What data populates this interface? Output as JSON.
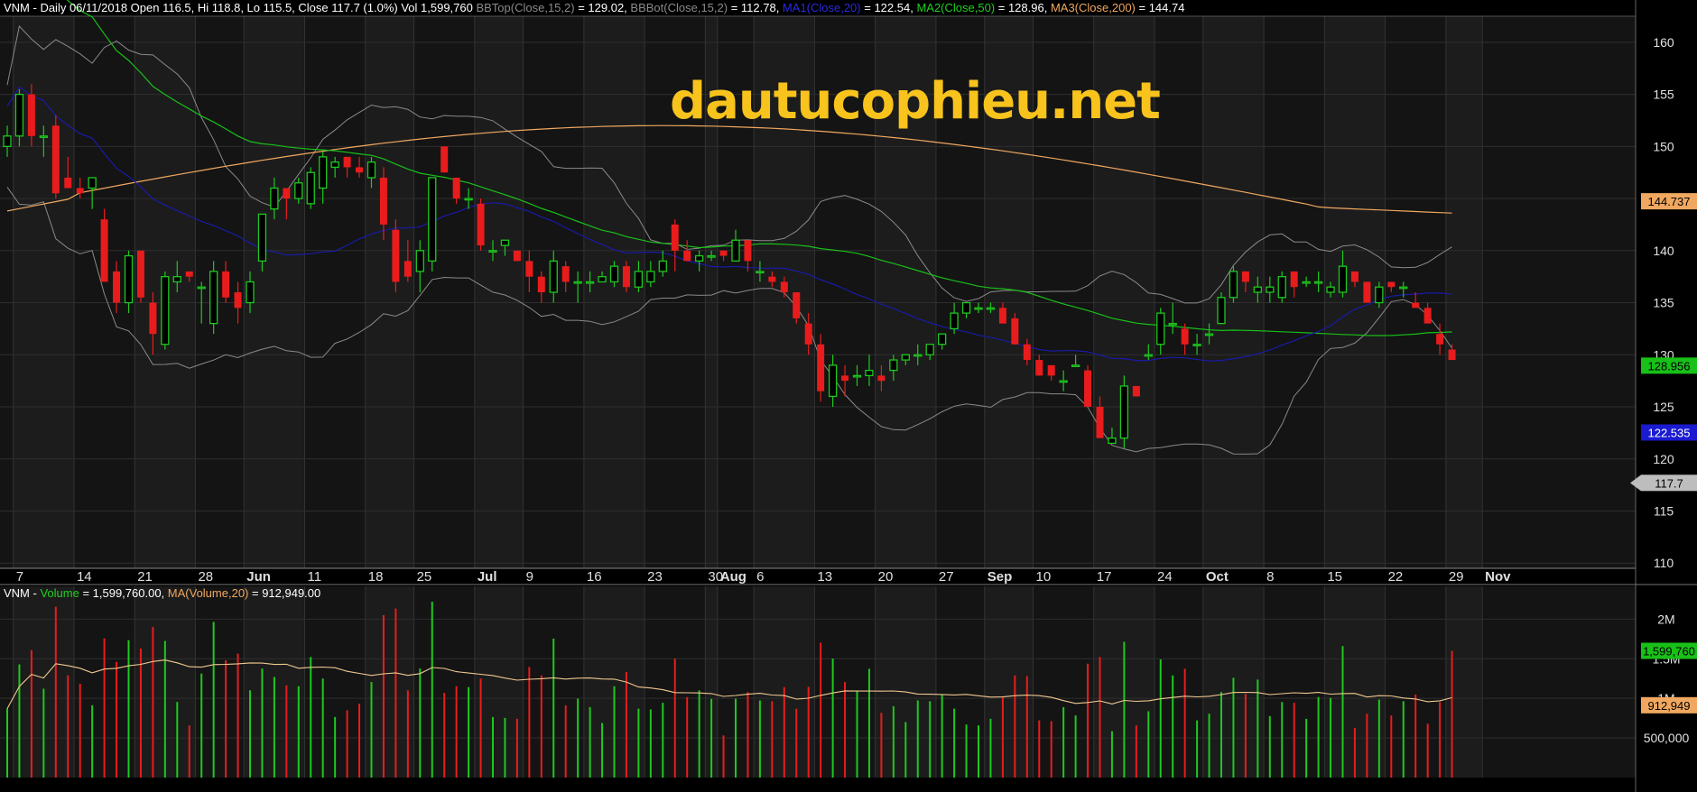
{
  "header": {
    "symbol": "VNM",
    "summary": " - Daily 06/11/2018 Open 116.5, Hi 118.8, Lo 115.5, Close 117.7 (1.0%) Vol 1,599,760 ",
    "bbtop_label": "BBTop(Close,15,2)",
    "bbtop_value": " = 129.02, ",
    "bbbot_label": "BBBot(Close,15,2)",
    "bbbot_value": " = 112.78, ",
    "ma1_label": "MA1(Close,20)",
    "ma1_value": " = 122.54, ",
    "ma2_label": "MA2(Close,50)",
    "ma2_value": " = 128.96, ",
    "ma3_label": "MA3(Close,200)",
    "ma3_value": " = 144.74"
  },
  "volume_header": {
    "symbol": "VNM",
    "sep": " - ",
    "vol_label": "Volume",
    "vol_value": " = 1,599,760.00, ",
    "ma_label": "MA(Volume,20)",
    "ma_value": " = 912,949.00"
  },
  "watermark": "dautucophieu.net",
  "colors": {
    "up": "#1ec81e",
    "down": "#e81c1c",
    "bb": "#8a8a8a",
    "ma1": "#1a1aa8",
    "ma2": "#18c018",
    "ma3": "#f0a860",
    "volma": "#f0c890"
  },
  "chart_data": {
    "type": "candlestick",
    "price_axis": {
      "ticks": [
        110,
        115,
        120,
        125,
        130,
        135,
        140,
        145,
        150,
        155,
        160
      ],
      "range": [
        109.5,
        162.5
      ]
    },
    "x_labels": [
      {
        "i": 1,
        "label": "7"
      },
      {
        "i": 6,
        "label": "14"
      },
      {
        "i": 11,
        "label": "21"
      },
      {
        "i": 16,
        "label": "28"
      },
      {
        "i": 20,
        "label": "Jun",
        "bold": true
      },
      {
        "i": 25,
        "label": "11"
      },
      {
        "i": 30,
        "label": "18"
      },
      {
        "i": 34,
        "label": "25"
      },
      {
        "i": 39,
        "label": "Jul",
        "bold": true
      },
      {
        "i": 43,
        "label": "9"
      },
      {
        "i": 48,
        "label": "16"
      },
      {
        "i": 53,
        "label": "23"
      },
      {
        "i": 58,
        "label": "30"
      },
      {
        "i": 59,
        "label": "Aug",
        "bold": true
      },
      {
        "i": 62,
        "label": "6"
      },
      {
        "i": 67,
        "label": "13"
      },
      {
        "i": 72,
        "label": "20"
      },
      {
        "i": 77,
        "label": "27"
      },
      {
        "i": 81,
        "label": "Sep",
        "bold": true
      },
      {
        "i": 85,
        "label": "10"
      },
      {
        "i": 90,
        "label": "17"
      },
      {
        "i": 95,
        "label": "24"
      },
      {
        "i": 99,
        "label": "Oct",
        "bold": true
      },
      {
        "i": 104,
        "label": "8"
      },
      {
        "i": 109,
        "label": "15"
      },
      {
        "i": 114,
        "label": "22"
      },
      {
        "i": 119,
        "label": "29"
      },
      {
        "i": 122,
        "label": "Nov",
        "bold": true
      }
    ],
    "ohlc": [
      [
        150,
        152,
        149,
        151
      ],
      [
        151,
        155.5,
        150,
        155
      ],
      [
        155,
        156,
        150,
        151
      ],
      [
        151,
        152,
        149,
        151
      ],
      [
        152,
        153,
        145,
        145.5
      ],
      [
        147,
        149,
        146,
        146
      ],
      [
        146,
        147,
        145,
        145.5
      ],
      [
        146,
        147,
        144,
        147
      ],
      [
        143,
        144,
        137,
        137
      ],
      [
        138,
        139,
        134,
        135
      ],
      [
        135,
        140,
        134,
        139.5
      ],
      [
        140,
        140,
        135,
        135.5
      ],
      [
        135,
        136,
        130,
        132
      ],
      [
        131,
        138,
        130.5,
        137.5
      ],
      [
        137,
        139,
        136,
        137.5
      ],
      [
        138,
        138,
        137,
        137.5
      ],
      [
        136.5,
        137,
        133,
        136.5
      ],
      [
        133,
        139,
        132,
        138
      ],
      [
        138,
        139,
        135,
        135.5
      ],
      [
        136,
        137,
        133,
        134.5
      ],
      [
        135,
        138,
        134,
        137
      ],
      [
        139,
        143,
        138,
        143.5
      ],
      [
        144,
        147,
        143,
        146
      ],
      [
        146,
        146,
        143,
        145
      ],
      [
        145,
        147,
        144.5,
        146.5
      ],
      [
        144.5,
        148,
        144,
        147.5
      ],
      [
        146,
        149.5,
        144.5,
        149
      ],
      [
        148,
        149,
        147,
        148.5
      ],
      [
        149,
        149,
        147,
        148
      ],
      [
        148,
        149,
        147,
        147.5
      ],
      [
        147,
        149,
        146,
        148.5
      ],
      [
        147,
        148,
        141,
        142.5
      ],
      [
        142,
        143,
        136,
        137
      ],
      [
        139,
        141,
        137,
        137.5
      ],
      [
        138,
        141,
        136,
        140
      ],
      [
        139,
        147,
        138,
        147
      ],
      [
        150,
        150,
        147.5,
        147.5
      ],
      [
        147,
        147,
        144.5,
        145
      ],
      [
        145,
        146,
        144,
        145
      ],
      [
        144.5,
        145,
        140,
        140.5
      ],
      [
        140,
        141,
        139,
        140
      ],
      [
        140.5,
        141,
        139.5,
        141
      ],
      [
        140,
        140,
        139,
        139
      ],
      [
        139,
        140,
        136,
        137.5
      ],
      [
        137.5,
        138,
        135,
        136
      ],
      [
        136,
        140,
        135,
        139
      ],
      [
        138.5,
        139,
        136,
        137
      ],
      [
        137,
        138,
        135,
        137
      ],
      [
        137,
        138,
        136,
        137
      ],
      [
        137,
        138,
        137.5,
        137.5
      ],
      [
        137,
        139,
        136.5,
        138.5
      ],
      [
        138.5,
        139,
        136,
        136.5
      ],
      [
        136.5,
        139,
        136,
        138
      ],
      [
        137,
        139,
        136.5,
        138
      ],
      [
        138,
        140,
        137.5,
        139
      ],
      [
        142.5,
        143,
        138,
        140
      ],
      [
        140,
        141,
        139,
        139
      ],
      [
        139,
        140,
        138,
        139.5
      ],
      [
        139.5,
        140,
        139,
        139.5
      ],
      [
        140,
        140,
        139,
        139.5
      ],
      [
        139,
        142,
        139,
        141
      ],
      [
        141,
        141,
        138,
        139
      ],
      [
        138,
        139,
        137,
        138
      ],
      [
        137.5,
        138,
        136.5,
        137
      ],
      [
        137,
        137.5,
        135.5,
        136
      ],
      [
        136,
        136,
        133,
        133.5
      ],
      [
        133,
        134,
        130,
        131
      ],
      [
        131,
        132,
        125.5,
        126.5
      ],
      [
        126,
        130,
        125,
        129
      ],
      [
        128,
        129,
        126,
        127.5
      ],
      [
        128,
        129,
        127,
        128
      ],
      [
        128,
        130,
        127,
        128.5
      ],
      [
        128,
        129,
        126.5,
        127.5
      ],
      [
        128.5,
        130,
        127.5,
        129.5
      ],
      [
        129.5,
        130,
        129,
        130
      ],
      [
        130,
        131,
        129,
        130
      ],
      [
        130,
        131,
        129.5,
        131
      ],
      [
        131,
        132,
        130.5,
        132
      ],
      [
        132.5,
        135,
        132,
        134
      ],
      [
        134,
        135,
        133.5,
        135
      ],
      [
        134.5,
        135,
        134,
        134.5
      ],
      [
        134.5,
        135,
        134,
        134.5
      ],
      [
        134.5,
        135,
        133,
        133
      ],
      [
        133.5,
        134,
        131,
        131
      ],
      [
        131,
        131.5,
        129,
        129.5
      ],
      [
        129.5,
        130,
        128,
        128
      ],
      [
        129,
        129,
        127.5,
        128
      ],
      [
        127.5,
        128.5,
        126.5,
        127.5
      ],
      [
        129,
        130,
        129,
        129
      ],
      [
        128.5,
        129,
        125,
        125
      ],
      [
        125,
        126,
        122,
        122
      ],
      [
        121.5,
        123,
        121.5,
        122
      ],
      [
        122,
        128,
        121,
        127
      ],
      [
        127,
        127,
        126,
        126
      ],
      [
        130,
        131,
        129.5,
        130
      ],
      [
        131,
        134.5,
        130,
        134
      ],
      [
        133,
        135,
        132,
        133
      ],
      [
        132.5,
        133,
        130,
        131
      ],
      [
        131,
        132,
        130,
        131
      ],
      [
        132,
        133,
        131,
        132
      ],
      [
        133,
        136,
        133,
        135.5
      ],
      [
        135.5,
        138.5,
        135,
        138
      ],
      [
        138,
        138,
        136,
        137
      ],
      [
        136,
        137.5,
        135,
        136.5
      ],
      [
        136,
        137.5,
        135,
        136.5
      ],
      [
        135.5,
        138,
        135,
        137.5
      ],
      [
        138,
        138,
        135.5,
        136.5
      ],
      [
        137,
        137.5,
        136.5,
        137
      ],
      [
        137,
        138,
        136,
        137
      ],
      [
        136,
        137,
        135.5,
        136.5
      ],
      [
        136,
        140,
        135.5,
        138.5
      ],
      [
        138,
        138,
        136.5,
        137
      ],
      [
        137,
        137,
        135,
        135
      ],
      [
        135,
        137,
        134.5,
        136.5
      ],
      [
        137,
        137,
        136,
        136.5
      ],
      [
        136.5,
        137,
        135.5,
        136.5
      ],
      [
        135,
        136,
        134.5,
        134.5
      ],
      [
        134.5,
        135,
        133,
        133
      ],
      [
        132,
        133,
        130,
        131
      ],
      [
        130.5,
        131,
        129.5,
        129.5
      ]
    ],
    "volume_axis": {
      "ticks": [
        {
          "v": 500000,
          "label": "500,000"
        },
        {
          "v": 1000000,
          "label": "1M"
        },
        {
          "v": 1500000,
          "label": "1.5M"
        },
        {
          "v": 2000000,
          "label": "2M"
        }
      ],
      "range": [
        0,
        2300000
      ]
    },
    "volume_note": "volume bars follow candle direction; see script",
    "badges": [
      {
        "series": "ma3",
        "value": 144.737,
        "text": "144.737"
      },
      {
        "series": "ma2",
        "value": 128.956,
        "text": "128.956"
      },
      {
        "series": "ma1",
        "value": 122.535,
        "text": "122.535"
      },
      {
        "series": "close",
        "value": 117.7,
        "text": "117.7"
      }
    ],
    "volume_badges": [
      {
        "series": "volume",
        "value": 1599760,
        "text": "1,599,760"
      },
      {
        "series": "volma",
        "value": 912949,
        "text": "912,949"
      }
    ]
  }
}
